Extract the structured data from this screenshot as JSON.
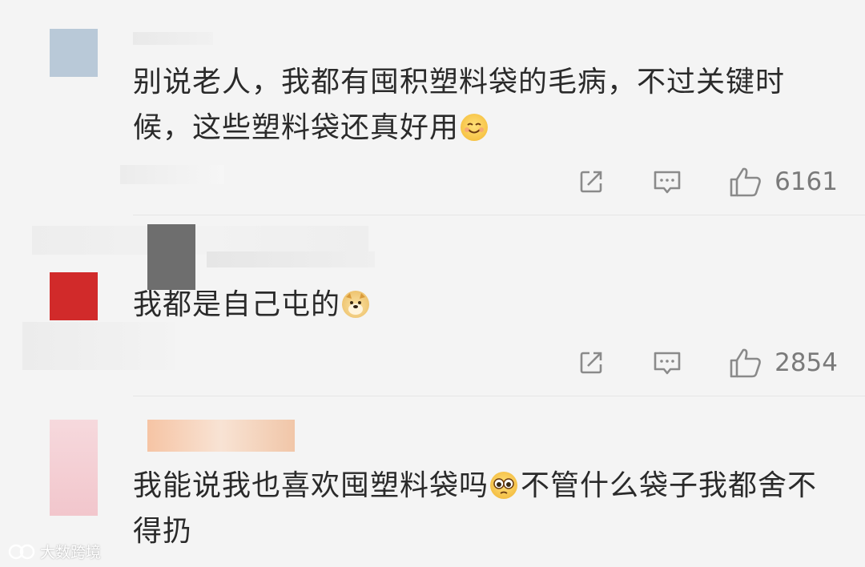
{
  "comments": [
    {
      "text": "别说老人，我都有囤积塑料袋的毛病，不过关键时候，这些塑料袋还真好用",
      "emoji": "smile-emoji",
      "likes": "6161"
    },
    {
      "text": "我都是自己屯的",
      "emoji": "doge-emoji",
      "likes": "2854"
    },
    {
      "text": "我能说我也喜欢囤塑料袋吗",
      "emoji": "tear-eyes-emoji",
      "text_after": "不管什么袋子我都舍不得扔"
    }
  ],
  "watermark": {
    "label": "大数跨境",
    "icon": "logo-icon"
  },
  "colors": {
    "background": "#f4f4f4",
    "text": "#2a2a2a",
    "icon": "#8a8a8a",
    "count": "#7a7a7a"
  }
}
